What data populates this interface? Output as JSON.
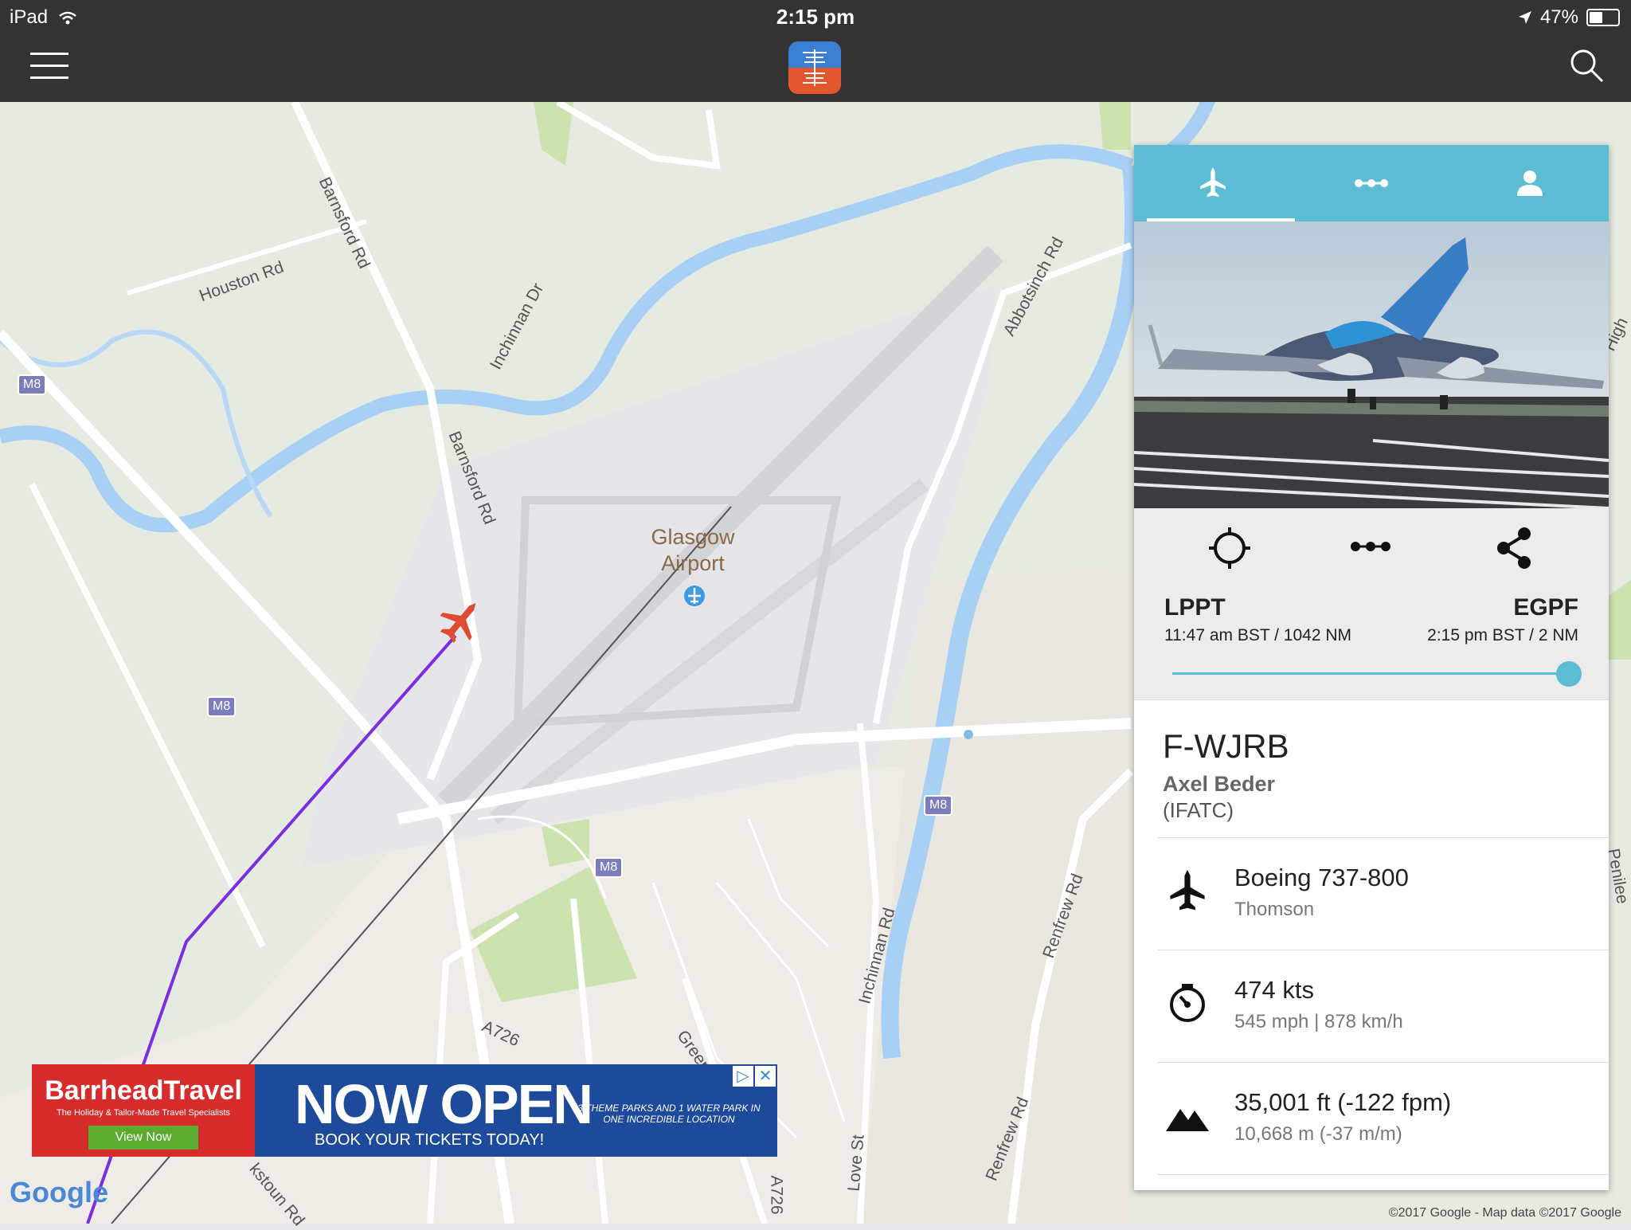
{
  "status_bar": {
    "device": "iPad",
    "time": "2:15 pm",
    "battery": "47%",
    "battery_fraction": 0.47
  },
  "map": {
    "airport_name_line1": "Glasgow",
    "airport_name_line2": "Airport",
    "streets": [
      "Houston Rd",
      "Barnsford Rd",
      "Barnsford Rd",
      "Inchinnan Dr",
      "Abbotsinch Rd",
      "Inchinnan Rd",
      "Renfrew Rd",
      "Renfrew Rd",
      "Love St",
      "A726",
      "A726",
      "Green",
      "kstoun Rd",
      "Penilee",
      "High"
    ],
    "motorway_shields": [
      "M8",
      "M8",
      "M8",
      "M8"
    ],
    "google_logo": "Google",
    "copyright": "©2017 Google - Map data ©2017 Google"
  },
  "ad": {
    "brand": "BarrheadTravel",
    "tagline": "The Holiday & Tailor-Made Travel Specialists",
    "cta": "View Now",
    "headline": "NOW OPEN",
    "subline": "BOOK YOUR TICKETS TODAY!",
    "detail": "3 THEME PARKS AND 1 WATER PARK IN ONE INCREDIBLE LOCATION",
    "close": "✕",
    "adchoices": "▷"
  },
  "panel": {
    "route": {
      "origin_code": "LPPT",
      "origin_info": "11:47 am BST / 1042 NM",
      "dest_code": "EGPF",
      "dest_info": "2:15 pm BST / 2 NM",
      "progress_fraction": 1.0
    },
    "registration": "F-WJRB",
    "pilot": "Axel Beder",
    "server": "(IFATC)",
    "aircraft": {
      "type": "Boeing 737-800",
      "livery": "Thomson"
    },
    "speed": {
      "primary": "474 kts",
      "secondary": "545 mph | 878 km/h"
    },
    "altitude": {
      "primary": "35,001 ft (-122 fpm)",
      "secondary": "10,668 m (-37 m/m)"
    }
  }
}
